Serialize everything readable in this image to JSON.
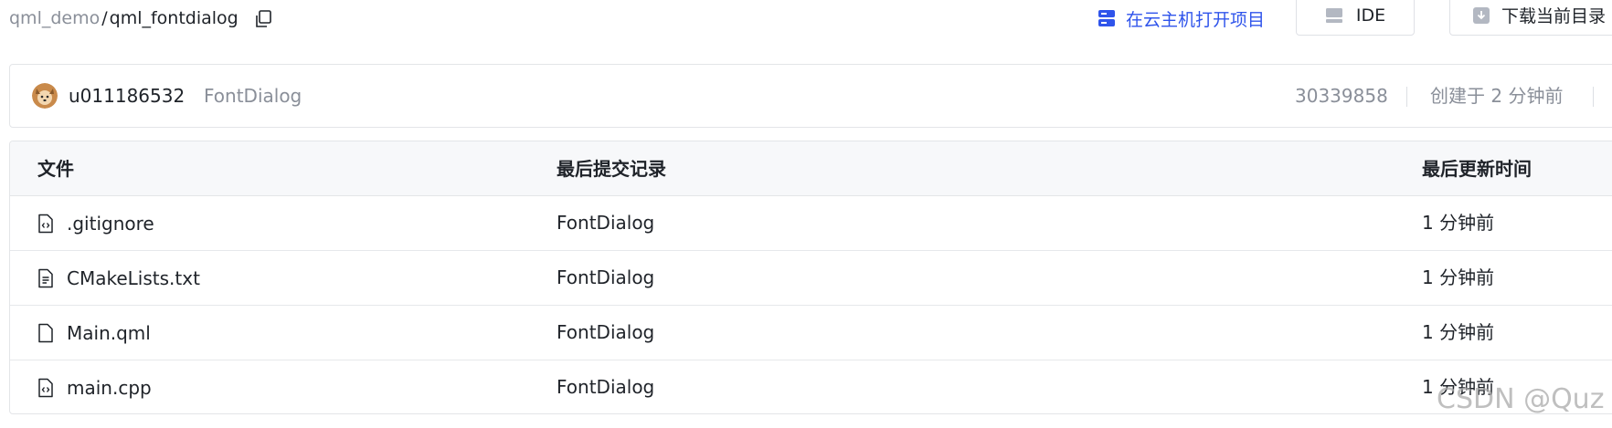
{
  "breadcrumb": {
    "repo": "qml_demo",
    "separator": "/",
    "current": "qml_fontdialog"
  },
  "actions": {
    "open_cloud": "在云主机打开项目",
    "ide": "IDE",
    "download": "下载当前目录"
  },
  "commit": {
    "author": "u011186532",
    "message": "FontDialog",
    "id": "30339858",
    "created": "创建于 2 分钟前"
  },
  "table": {
    "headers": {
      "file": "文件",
      "commit": "最后提交记录",
      "time": "最后更新时间"
    },
    "rows": [
      {
        "name": ".gitignore",
        "icon": "code-file-icon",
        "commit": "FontDialog",
        "time": "1 分钟前"
      },
      {
        "name": "CMakeLists.txt",
        "icon": "text-file-icon",
        "commit": "FontDialog",
        "time": "1 分钟前"
      },
      {
        "name": "Main.qml",
        "icon": "file-icon",
        "commit": "FontDialog",
        "time": "1 分钟前"
      },
      {
        "name": "main.cpp",
        "icon": "code-file-icon",
        "commit": "FontDialog",
        "time": "1 分钟前"
      }
    ]
  },
  "watermark": "CSDN @Quz",
  "colors": {
    "accent": "#2f54eb",
    "muted": "#8a8f99",
    "border": "#e3e5e8",
    "header_bg": "#f7f8fa"
  }
}
